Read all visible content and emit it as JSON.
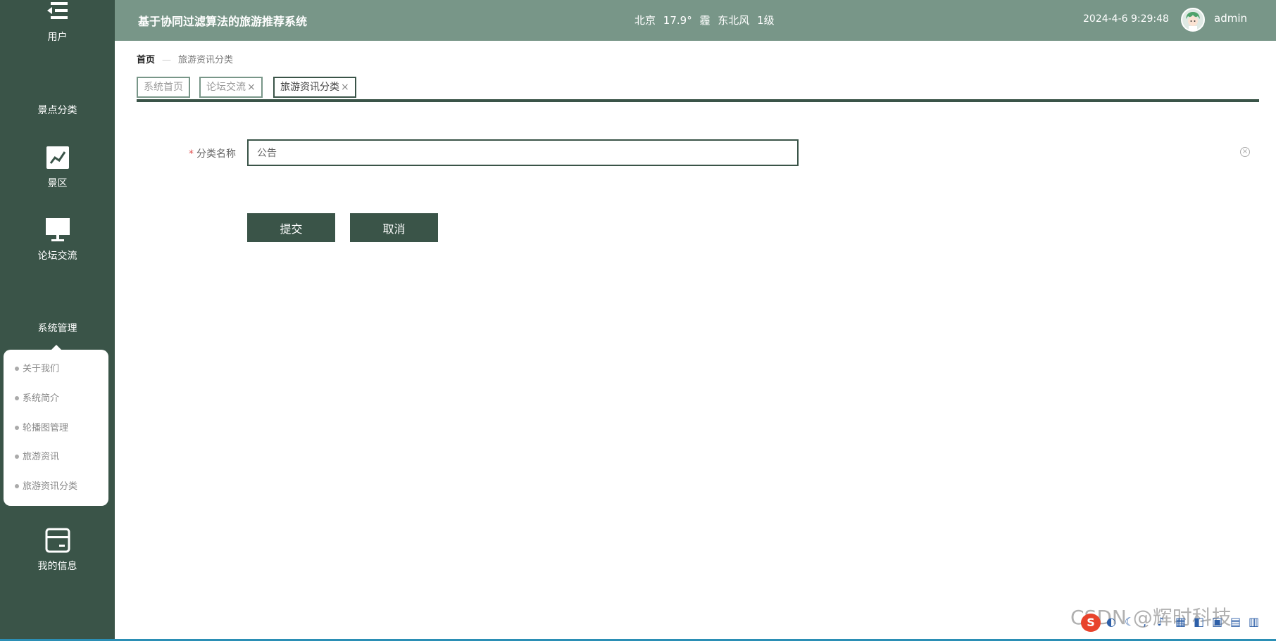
{
  "header": {
    "title": "基于协同过滤算法的旅游推荐系统",
    "weather": {
      "city": "北京",
      "temp": "17.9°",
      "condition": "霾",
      "wind": "东北风",
      "level": "1级"
    },
    "datetime": "2024-4-6 9:29:48",
    "username": "admin"
  },
  "sidebar": {
    "items": [
      {
        "label": "用户",
        "icon": "user-list-icon"
      },
      {
        "label": "景点分类",
        "icon": "grid-icon"
      },
      {
        "label": "景区",
        "icon": "chart-icon"
      },
      {
        "label": "论坛交流",
        "icon": "monitor-icon"
      },
      {
        "label": "系统管理",
        "icon": "grid-icon"
      },
      {
        "label": "我的信息",
        "icon": "card-icon"
      }
    ],
    "submenu": [
      "关于我们",
      "系统简介",
      "轮播图管理",
      "旅游资讯",
      "旅游资讯分类"
    ]
  },
  "breadcrumb": {
    "home": "首页",
    "separator": "—",
    "current": "旅游资讯分类"
  },
  "tabs": [
    {
      "label": "系统首页",
      "closable": false
    },
    {
      "label": "论坛交流",
      "closable": true
    },
    {
      "label": "旅游资讯分类",
      "closable": true
    }
  ],
  "form": {
    "required_mark": "*",
    "field_label": "分类名称",
    "field_value": "公告",
    "submit_label": "提交",
    "cancel_label": "取消"
  },
  "close_glyph": "×",
  "watermark": "CSDN @辉时科技",
  "colors": {
    "sidebar": "#3a5448",
    "header": "#789688",
    "accent": "#3a5448"
  }
}
